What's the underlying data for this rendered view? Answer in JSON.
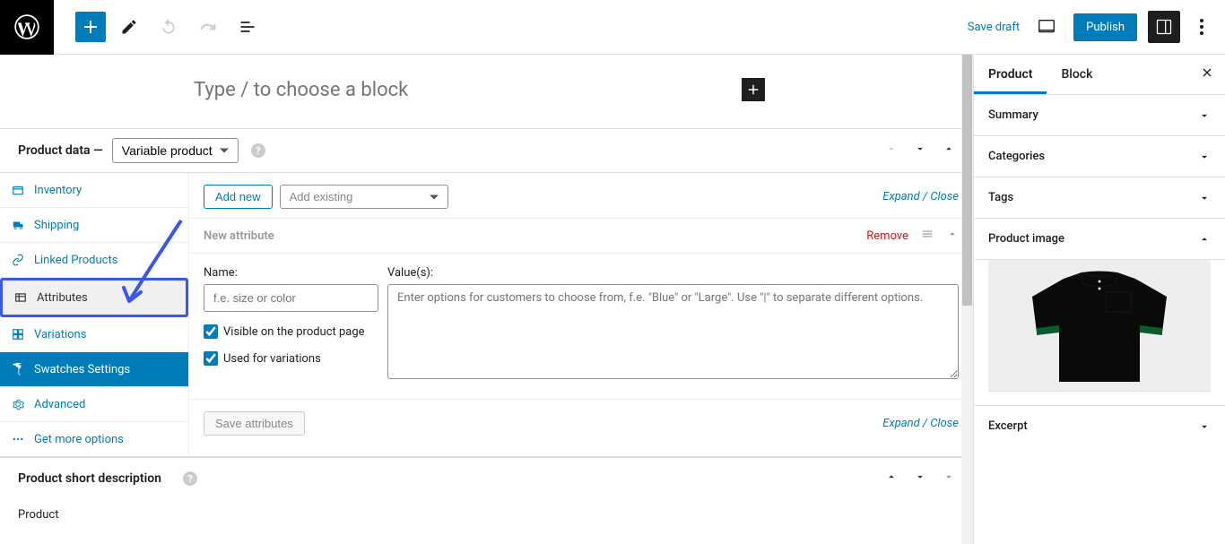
{
  "header": {
    "save_draft": "Save draft",
    "publish": "Publish"
  },
  "block_prompt": "Type / to choose a block",
  "product_data": {
    "title": "Product data —",
    "type": "Variable product",
    "tabs": {
      "inventory": "Inventory",
      "shipping": "Shipping",
      "linked": "Linked Products",
      "attributes": "Attributes",
      "variations": "Variations",
      "swatches": "Swatches Settings",
      "advanced": "Advanced",
      "more": "Get more options"
    },
    "add_new": "Add new",
    "add_existing": "Add existing",
    "expand_close": "Expand / Close",
    "new_attribute": "New attribute",
    "remove": "Remove",
    "name_label": "Name:",
    "name_placeholder": "f.e. size or color",
    "values_label": "Value(s):",
    "values_placeholder": "Enter options for customers to choose from, f.e. \"Blue\" or \"Large\". Use \"|\" to separate different options.",
    "visible": "Visible on the product page",
    "used_variations": "Used for variations",
    "save_attributes": "Save attributes"
  },
  "short_description": "Product short description",
  "footer_product": "Product",
  "sidebar": {
    "tab_product": "Product",
    "tab_block": "Block",
    "sections": {
      "summary": "Summary",
      "categories": "Categories",
      "tags": "Tags",
      "product_image": "Product image",
      "excerpt": "Excerpt"
    }
  }
}
